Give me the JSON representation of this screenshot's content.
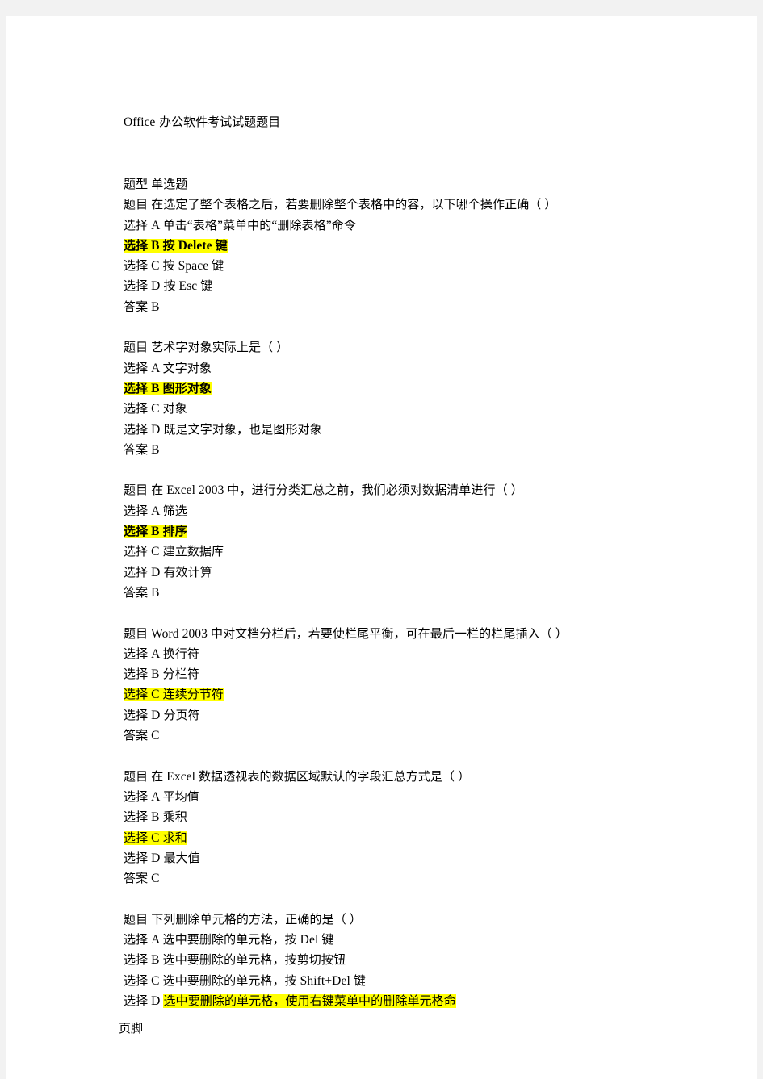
{
  "document": {
    "title": "Office 办公软件考试试题题目",
    "title_latin": "Office",
    "title_cjk": " 办公软件考试试题题目",
    "footer": "页脚",
    "highlight_color": "#ffff00",
    "page_background": "#ffffff",
    "canvas_background": "#f2f2f2"
  },
  "labels": {
    "type_label": "题型",
    "question_label": "题目",
    "choice_label": "选择",
    "answer_label": "答案"
  },
  "question_type": "单选题",
  "questions": [
    {
      "stem": "在选定了整个表格之后，若要删除整个表格中的容，以下哪个操作正确（      ）",
      "options": [
        {
          "key": "A",
          "text": "单击“表格”菜单中的“删除表格”命令",
          "highlight": false,
          "bold": false
        },
        {
          "key": "B",
          "text": "按 Delete 键",
          "highlight": true,
          "bold": true
        },
        {
          "key": "C",
          "text": "按 Space 键",
          "highlight": false,
          "bold": false
        },
        {
          "key": "D",
          "text": "按 Esc 键",
          "highlight": false,
          "bold": false
        }
      ],
      "answer": "B"
    },
    {
      "stem": "艺术字对象实际上是（      ）",
      "options": [
        {
          "key": "A",
          "text": "文字对象",
          "highlight": false,
          "bold": false
        },
        {
          "key": "B",
          "text": "图形对象",
          "highlight": true,
          "bold": true
        },
        {
          "key": "C",
          "text": "对象",
          "highlight": false,
          "bold": false
        },
        {
          "key": "D",
          "text": "既是文字对象，也是图形对象",
          "highlight": false,
          "bold": false
        }
      ],
      "answer": "B"
    },
    {
      "stem": "在 Excel 2003  中，进行分类汇总之前，我们必须对数据清单进行（   ）",
      "options": [
        {
          "key": "A",
          "text": "筛选",
          "highlight": false,
          "bold": false
        },
        {
          "key": "B",
          "text": "排序",
          "highlight": true,
          "bold": true
        },
        {
          "key": "C",
          "text": "建立数据库",
          "highlight": false,
          "bold": false
        },
        {
          "key": "D",
          "text": "有效计算",
          "highlight": false,
          "bold": false
        }
      ],
      "answer": "B"
    },
    {
      "stem": "Word 2003  中对文档分栏后，若要使栏尾平衡，可在最后一栏的栏尾插入（    ）",
      "options": [
        {
          "key": "A",
          "text": "换行符",
          "highlight": false,
          "bold": false
        },
        {
          "key": "B",
          "text": "分栏符",
          "highlight": false,
          "bold": false
        },
        {
          "key": "C",
          "text": "连续分节符",
          "highlight": true,
          "bold": false
        },
        {
          "key": "D",
          "text": "分页符",
          "highlight": false,
          "bold": false
        }
      ],
      "answer": "C"
    },
    {
      "stem": "在 Excel  数据透视表的数据区域默认的字段汇总方式是（   ）",
      "options": [
        {
          "key": "A",
          "text": "平均值",
          "highlight": false,
          "bold": false
        },
        {
          "key": "B",
          "text": "乘积",
          "highlight": false,
          "bold": false
        },
        {
          "key": "C",
          "text": "求和",
          "highlight": true,
          "bold": false
        },
        {
          "key": "D",
          "text": "最大值",
          "highlight": false,
          "bold": false
        }
      ],
      "answer": "C"
    },
    {
      "stem": "下列删除单元格的方法，正确的是（   ）",
      "options": [
        {
          "key": "A",
          "text": "选中要删除的单元格，按 Del 键",
          "highlight": false,
          "bold": false
        },
        {
          "key": "B",
          "text": "选中要删除的单元格，按剪切按钮",
          "highlight": false,
          "bold": false
        },
        {
          "key": "C",
          "text": "选中要删除的单元格，按 Shift+Del 键",
          "highlight": false,
          "bold": false
        },
        {
          "key": "D",
          "text": "选中要删除的单元格，使用右键菜单中的删除单元格命",
          "highlight": true,
          "bold": false,
          "highlight_text_only": true
        }
      ],
      "answer": null
    }
  ]
}
